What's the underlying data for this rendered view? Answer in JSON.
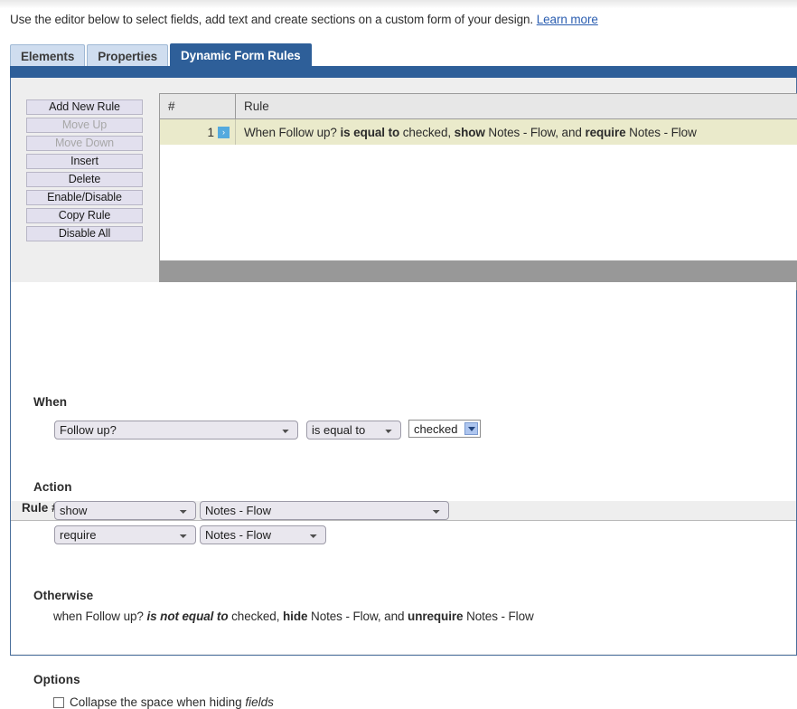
{
  "intro": {
    "text": "Use the editor below to select fields, add text and create sections on a custom form of your design.",
    "link_label": "Learn more"
  },
  "tabs": [
    {
      "label": "Elements",
      "active": false
    },
    {
      "label": "Properties",
      "active": false
    },
    {
      "label": "Dynamic Form Rules",
      "active": true
    }
  ],
  "side_buttons": [
    {
      "label": "Add New Rule",
      "disabled": false
    },
    {
      "label": "Move Up",
      "disabled": true
    },
    {
      "label": "Move Down",
      "disabled": true
    },
    {
      "label": "Insert",
      "disabled": false
    },
    {
      "label": "Delete",
      "disabled": false
    },
    {
      "label": "Enable/Disable",
      "disabled": false
    },
    {
      "label": "Copy Rule",
      "disabled": false
    },
    {
      "label": "Disable All",
      "disabled": false
    }
  ],
  "grid": {
    "headers": {
      "number": "#",
      "rule": "Rule"
    },
    "rows": [
      {
        "number": "1",
        "flag_icon": "chevron-right-icon",
        "flag_glyph": "›",
        "text_parts": [
          {
            "text": "When Follow up? ",
            "style": "normal"
          },
          {
            "text": "is equal to",
            "style": "bold"
          },
          {
            "text": " checked, ",
            "style": "normal"
          },
          {
            "text": "show",
            "style": "bold"
          },
          {
            "text": " Notes - Flow, and ",
            "style": "normal"
          },
          {
            "text": "require",
            "style": "bold"
          },
          {
            "text": " Notes - Flow",
            "style": "normal"
          }
        ],
        "plain_text": "When Follow up? is equal to checked, show Notes - Flow, and require Notes - Flow"
      }
    ]
  },
  "rule_detail": {
    "title": "Rule #1",
    "when": {
      "label": "When",
      "field_value": "Follow up?",
      "operator_value": "is equal to",
      "compare_value": "checked"
    },
    "action": {
      "label": "Action",
      "rows": [
        {
          "action_value": "show",
          "target_value": "Notes - Flow"
        },
        {
          "action_value": "require",
          "target_value": "Notes - Flow"
        }
      ]
    },
    "otherwise": {
      "label": "Otherwise",
      "text_parts": [
        {
          "text": "when Follow up? ",
          "style": "normal"
        },
        {
          "text": "is not equal to",
          "style": "bold-italic"
        },
        {
          "text": " checked, ",
          "style": "normal"
        },
        {
          "text": "hide",
          "style": "bold"
        },
        {
          "text": " Notes - Flow, and ",
          "style": "normal"
        },
        {
          "text": "unrequire",
          "style": "bold"
        },
        {
          "text": " Notes - Flow",
          "style": "normal"
        }
      ],
      "plain_text": "when Follow up? is not equal to checked, hide Notes - Flow, and unrequire Notes - Flow"
    },
    "options": {
      "label": "Options",
      "items": [
        {
          "checked": false,
          "text_parts": [
            {
              "text": "Collapse the space when hiding ",
              "style": "normal"
            },
            {
              "text": "fields",
              "style": "italic"
            }
          ],
          "plain_text": "Collapse the space when hiding fields"
        }
      ]
    }
  },
  "colors": {
    "accent_blue": "#2e5f99",
    "tab_inactive": "#cfddef",
    "row_highlight": "#eaeacb",
    "panel_bg": "#eeeeee",
    "footer_grey": "#989898",
    "link_blue": "#2a5db0",
    "flag_blue": "#54aade"
  }
}
